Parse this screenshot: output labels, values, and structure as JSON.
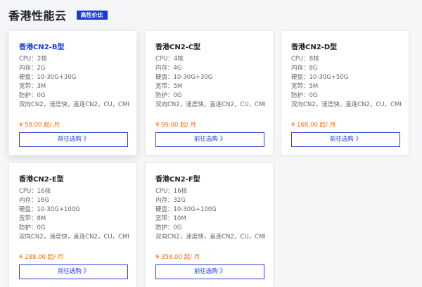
{
  "header": {
    "title": "香港性能云",
    "badge": "高性价比"
  },
  "cards": [
    {
      "name": "香港CN2-B型",
      "specs": [
        "CPU：2核",
        "内存：2G",
        "硬盘：10-30G+30G",
        "宽带：3M",
        "防护：0G",
        "双向CN2，速度快，直连CN2，CU，CMI"
      ],
      "price": "¥ 58.00 起/ 月",
      "button": "前往选购 》"
    },
    {
      "name": "香港CN2-C型",
      "specs": [
        "CPU：4核",
        "内存：4G",
        "硬盘：10-30G+30G",
        "宽带：5M",
        "防护：0G",
        "双向CN2，速度快，直连CN2，CU，CMI"
      ],
      "price": "¥ 99.00 起/ 月",
      "button": "前往选购 》"
    },
    {
      "name": "香港CN2-D型",
      "specs": [
        "CPU：8核",
        "内存：8G",
        "硬盘：10-30G+50G",
        "宽带：5M",
        "防护：0G",
        "双向CN2，速度快，直连CN2，CU，CMI"
      ],
      "price": "¥ 168.00 起/ 月",
      "button": "前往选购 》"
    },
    {
      "name": "香港CN2-E型",
      "specs": [
        "CPU：16核",
        "内存：16G",
        "硬盘：10-30G+100G",
        "宽带：8M",
        "防护：0G",
        "双向CN2，速度快，直连CN2，CU，CMI"
      ],
      "price": "¥ 288.00 起/ 月",
      "button": "前往选购 》"
    },
    {
      "name": "香港CN2-F型",
      "specs": [
        "CPU：16核",
        "内存：32G",
        "硬盘：10-30G+100G",
        "宽带：10M",
        "防护：0G",
        "双向CN2，速度快，直连CN2，CU，CMI"
      ],
      "price": "¥ 358.00 起/ 月",
      "button": "前往选购 》"
    }
  ]
}
